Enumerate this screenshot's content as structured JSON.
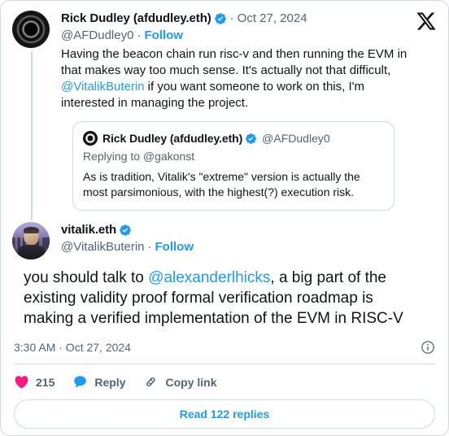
{
  "card": {
    "brand_logo": "x-logo",
    "accent_color": "#1d9bf0",
    "text_color": "#0f1419",
    "muted_color": "#536471",
    "border_color": "#cfd9de",
    "like_color": "#f91880"
  },
  "parent_tweet": {
    "display_name": "Rick Dudley (afdudley.eth)",
    "verified": true,
    "separator": "·",
    "date": "Oct 27, 2024",
    "handle": "@AFDudley0",
    "handle_separator": "·",
    "follow_label": "Follow",
    "text_part1": "Having the beacon chain run risc-v and then running the EVM in that makes way too much sense. It's actually not that difficult, ",
    "mention": "@VitalikButerin",
    "text_part2": " if you want someone to work on this, I'm interested in managing the project."
  },
  "quoted_tweet": {
    "display_name": "Rick Dudley (afdudley.eth)",
    "verified": true,
    "handle": "@AFDudley0",
    "replying_to": "Replying to @gakonst",
    "text": "As is tradition, Vitalik's \"extreme\" version is actually the most parsimonious, with the highest(?) execution risk."
  },
  "main_tweet": {
    "display_name": "vitalik.eth",
    "verified": true,
    "handle": "@VitalikButerin",
    "handle_separator": "·",
    "follow_label": "Follow",
    "text_part1": "you should talk to ",
    "mention": "@alexanderlhicks",
    "text_part2": ", a big part of the existing validity proof formal verification roadmap is making a verified implementation of the EVM in RISC-V",
    "timestamp": "3:30 AM · Oct 27, 2024",
    "info_icon": "info-circle-icon"
  },
  "actions": {
    "like": {
      "icon": "heart-icon",
      "count": "215"
    },
    "reply": {
      "icon": "speech-bubble-icon",
      "label": "Reply"
    },
    "copy_link": {
      "icon": "link-icon",
      "label": "Copy link"
    }
  },
  "footer": {
    "read_replies_label": "Read 122 replies"
  }
}
